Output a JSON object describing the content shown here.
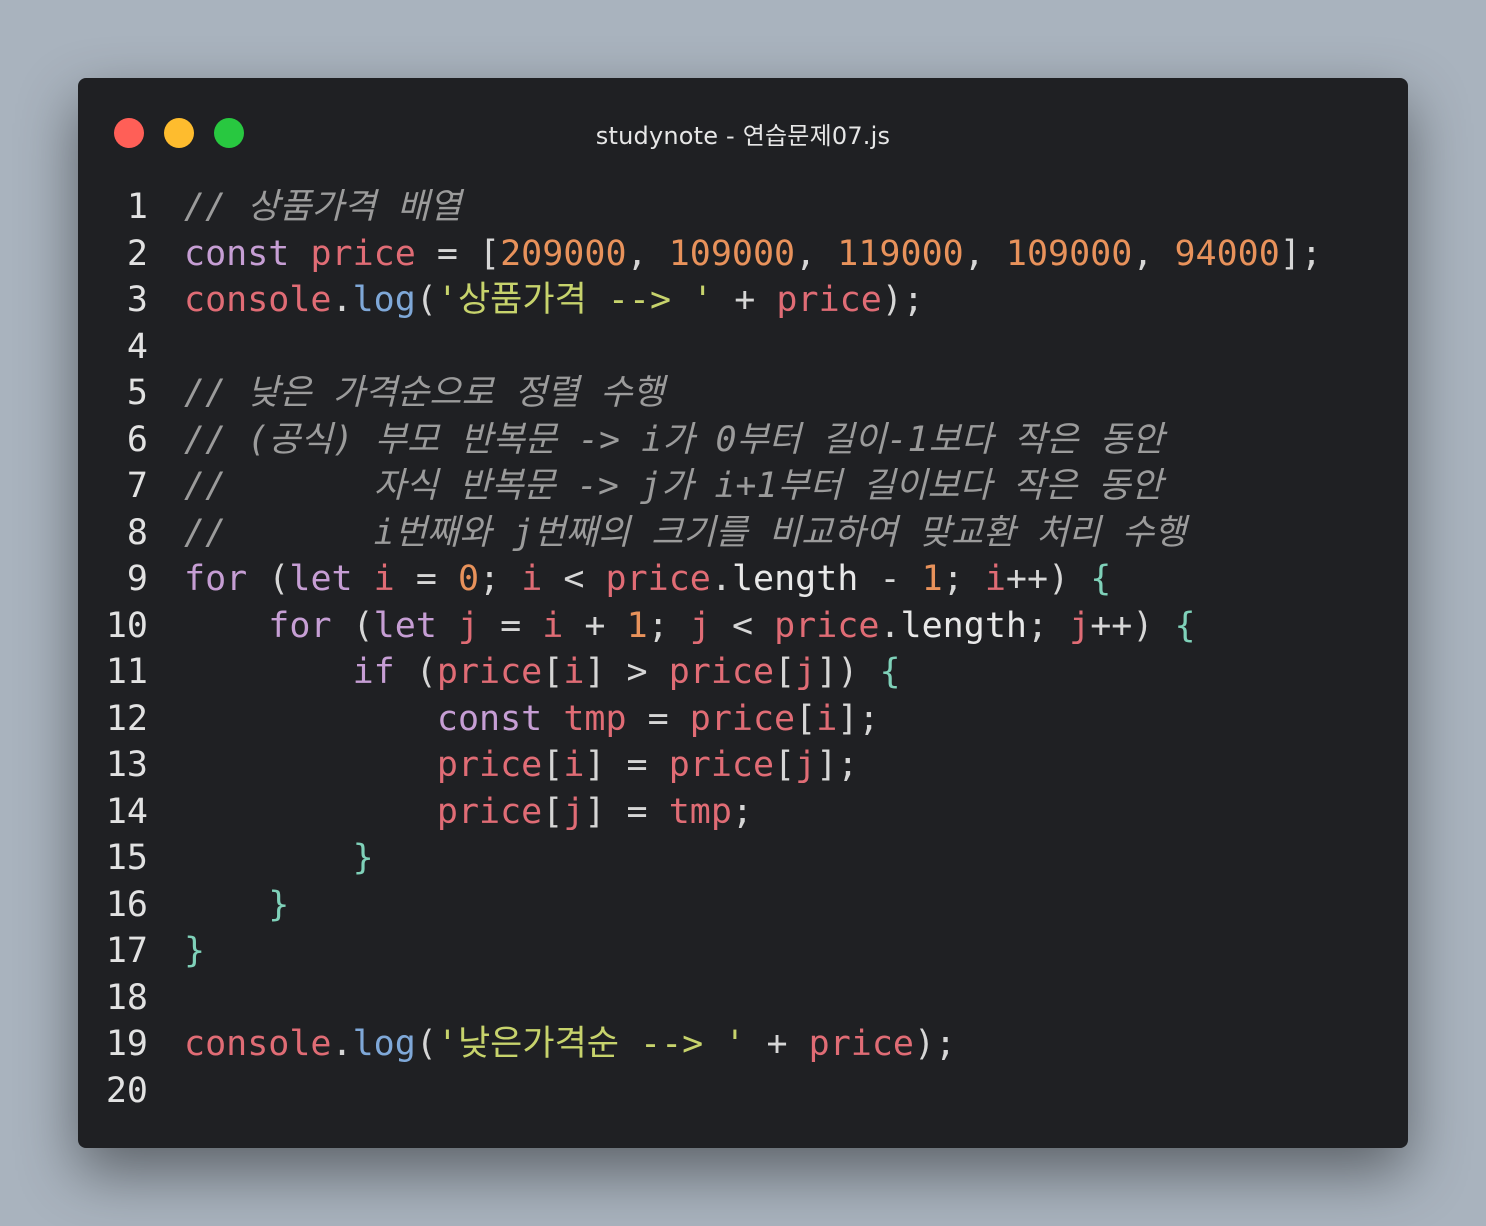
{
  "window": {
    "title": "studynote - 연습문제07.js",
    "controls": [
      {
        "name": "close",
        "color": "#ff5f57"
      },
      {
        "name": "minimize",
        "color": "#febc2e"
      },
      {
        "name": "maximize",
        "color": "#28c840"
      }
    ]
  },
  "code_lines": [
    {
      "number": "1",
      "tokens": [
        {
          "t": "// 상품가격 배열",
          "c": "comment"
        }
      ]
    },
    {
      "number": "2",
      "tokens": [
        {
          "t": "const",
          "c": "kw"
        },
        {
          "t": " ",
          "c": "punc"
        },
        {
          "t": "price",
          "c": "var"
        },
        {
          "t": " = ",
          "c": "op"
        },
        {
          "t": "[",
          "c": "punc"
        },
        {
          "t": "209000",
          "c": "num"
        },
        {
          "t": ", ",
          "c": "punc"
        },
        {
          "t": "109000",
          "c": "num"
        },
        {
          "t": ", ",
          "c": "punc"
        },
        {
          "t": "119000",
          "c": "num"
        },
        {
          "t": ", ",
          "c": "punc"
        },
        {
          "t": "109000",
          "c": "num"
        },
        {
          "t": ", ",
          "c": "punc"
        },
        {
          "t": "94000",
          "c": "num"
        },
        {
          "t": "];",
          "c": "punc"
        }
      ]
    },
    {
      "number": "3",
      "tokens": [
        {
          "t": "console",
          "c": "var"
        },
        {
          "t": ".",
          "c": "punc"
        },
        {
          "t": "log",
          "c": "fn"
        },
        {
          "t": "(",
          "c": "punc"
        },
        {
          "t": "'상품가격 --> '",
          "c": "str"
        },
        {
          "t": " + ",
          "c": "op"
        },
        {
          "t": "price",
          "c": "var"
        },
        {
          "t": ");",
          "c": "punc"
        }
      ]
    },
    {
      "number": "4",
      "tokens": []
    },
    {
      "number": "5",
      "tokens": [
        {
          "t": "// 낮은 가격순으로 정렬 수행",
          "c": "comment"
        }
      ]
    },
    {
      "number": "6",
      "tokens": [
        {
          "t": "// (공식) 부모 반복문 -> i가 0부터 길이-1보다 작은 동안",
          "c": "comment"
        }
      ]
    },
    {
      "number": "7",
      "tokens": [
        {
          "t": "//       자식 반복문 -> j가 i+1부터 길이보다 작은 동안",
          "c": "comment"
        }
      ]
    },
    {
      "number": "8",
      "tokens": [
        {
          "t": "//       i번째와 j번째의 크기를 비교하여 맞교환 처리 수행",
          "c": "comment"
        }
      ]
    },
    {
      "number": "9",
      "tokens": [
        {
          "t": "for",
          "c": "kw"
        },
        {
          "t": " (",
          "c": "punc"
        },
        {
          "t": "let",
          "c": "kw"
        },
        {
          "t": " ",
          "c": "punc"
        },
        {
          "t": "i",
          "c": "var"
        },
        {
          "t": " = ",
          "c": "op"
        },
        {
          "t": "0",
          "c": "num"
        },
        {
          "t": "; ",
          "c": "punc"
        },
        {
          "t": "i",
          "c": "var"
        },
        {
          "t": " < ",
          "c": "op"
        },
        {
          "t": "price",
          "c": "var"
        },
        {
          "t": ".",
          "c": "punc"
        },
        {
          "t": "length",
          "c": "prop"
        },
        {
          "t": " - ",
          "c": "op"
        },
        {
          "t": "1",
          "c": "num"
        },
        {
          "t": "; ",
          "c": "punc"
        },
        {
          "t": "i",
          "c": "var"
        },
        {
          "t": "++",
          "c": "op"
        },
        {
          "t": ") ",
          "c": "punc"
        },
        {
          "t": "{",
          "c": "brace"
        }
      ]
    },
    {
      "number": "10",
      "tokens": [
        {
          "t": "    ",
          "c": "punc"
        },
        {
          "t": "for",
          "c": "kw"
        },
        {
          "t": " (",
          "c": "punc"
        },
        {
          "t": "let",
          "c": "kw"
        },
        {
          "t": " ",
          "c": "punc"
        },
        {
          "t": "j",
          "c": "var"
        },
        {
          "t": " = ",
          "c": "op"
        },
        {
          "t": "i",
          "c": "var"
        },
        {
          "t": " + ",
          "c": "op"
        },
        {
          "t": "1",
          "c": "num"
        },
        {
          "t": "; ",
          "c": "punc"
        },
        {
          "t": "j",
          "c": "var"
        },
        {
          "t": " < ",
          "c": "op"
        },
        {
          "t": "price",
          "c": "var"
        },
        {
          "t": ".",
          "c": "punc"
        },
        {
          "t": "length",
          "c": "prop"
        },
        {
          "t": "; ",
          "c": "punc"
        },
        {
          "t": "j",
          "c": "var"
        },
        {
          "t": "++",
          "c": "op"
        },
        {
          "t": ") ",
          "c": "punc"
        },
        {
          "t": "{",
          "c": "brace"
        }
      ]
    },
    {
      "number": "11",
      "tokens": [
        {
          "t": "        ",
          "c": "punc"
        },
        {
          "t": "if",
          "c": "kw"
        },
        {
          "t": " (",
          "c": "punc"
        },
        {
          "t": "price",
          "c": "var"
        },
        {
          "t": "[",
          "c": "punc"
        },
        {
          "t": "i",
          "c": "var"
        },
        {
          "t": "]",
          "c": "punc"
        },
        {
          "t": " > ",
          "c": "op"
        },
        {
          "t": "price",
          "c": "var"
        },
        {
          "t": "[",
          "c": "punc"
        },
        {
          "t": "j",
          "c": "var"
        },
        {
          "t": "]) ",
          "c": "punc"
        },
        {
          "t": "{",
          "c": "brace"
        }
      ]
    },
    {
      "number": "12",
      "tokens": [
        {
          "t": "            ",
          "c": "punc"
        },
        {
          "t": "const",
          "c": "kw"
        },
        {
          "t": " ",
          "c": "punc"
        },
        {
          "t": "tmp",
          "c": "var"
        },
        {
          "t": " = ",
          "c": "op"
        },
        {
          "t": "price",
          "c": "var"
        },
        {
          "t": "[",
          "c": "punc"
        },
        {
          "t": "i",
          "c": "var"
        },
        {
          "t": "];",
          "c": "punc"
        }
      ]
    },
    {
      "number": "13",
      "tokens": [
        {
          "t": "            ",
          "c": "punc"
        },
        {
          "t": "price",
          "c": "var"
        },
        {
          "t": "[",
          "c": "punc"
        },
        {
          "t": "i",
          "c": "var"
        },
        {
          "t": "]",
          "c": "punc"
        },
        {
          "t": " = ",
          "c": "op"
        },
        {
          "t": "price",
          "c": "var"
        },
        {
          "t": "[",
          "c": "punc"
        },
        {
          "t": "j",
          "c": "var"
        },
        {
          "t": "];",
          "c": "punc"
        }
      ]
    },
    {
      "number": "14",
      "tokens": [
        {
          "t": "            ",
          "c": "punc"
        },
        {
          "t": "price",
          "c": "var"
        },
        {
          "t": "[",
          "c": "punc"
        },
        {
          "t": "j",
          "c": "var"
        },
        {
          "t": "]",
          "c": "punc"
        },
        {
          "t": " = ",
          "c": "op"
        },
        {
          "t": "tmp",
          "c": "var"
        },
        {
          "t": ";",
          "c": "punc"
        }
      ]
    },
    {
      "number": "15",
      "tokens": [
        {
          "t": "        ",
          "c": "punc"
        },
        {
          "t": "}",
          "c": "brace"
        }
      ]
    },
    {
      "number": "16",
      "tokens": [
        {
          "t": "    ",
          "c": "punc"
        },
        {
          "t": "}",
          "c": "brace"
        }
      ]
    },
    {
      "number": "17",
      "tokens": [
        {
          "t": "}",
          "c": "brace"
        }
      ]
    },
    {
      "number": "18",
      "tokens": []
    },
    {
      "number": "19",
      "tokens": [
        {
          "t": "console",
          "c": "var"
        },
        {
          "t": ".",
          "c": "punc"
        },
        {
          "t": "log",
          "c": "fn"
        },
        {
          "t": "(",
          "c": "punc"
        },
        {
          "t": "'낮은가격순 --> '",
          "c": "str"
        },
        {
          "t": " + ",
          "c": "op"
        },
        {
          "t": "price",
          "c": "var"
        },
        {
          "t": ");",
          "c": "punc"
        }
      ]
    },
    {
      "number": "20",
      "tokens": []
    }
  ]
}
